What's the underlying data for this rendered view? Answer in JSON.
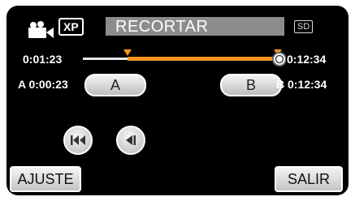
{
  "header": {
    "mode_icon": "movie-camera-icon",
    "quality_badge": "XP",
    "title": "RECORTAR",
    "media_badge": "SD"
  },
  "timeline": {
    "current_time": "0:01:23",
    "total_time": "0:12:34",
    "playhead_fraction": 1.0,
    "marker_a_fraction": 0.22,
    "marker_b_fraction": 0.96,
    "colors": {
      "track": "#e8e8e8",
      "selection": "#f5941f",
      "marker": "#f5941f"
    }
  },
  "points": {
    "a_label": "A 0:00:23",
    "a_button": "A",
    "b_label": "B 0:12:34",
    "b_button": "B"
  },
  "playback": {
    "skip_back_icon": "skip-to-start-icon",
    "step_back_icon": "frame-back-icon"
  },
  "footer": {
    "left_button": "AJUSTE",
    "right_button": "SALIR"
  }
}
